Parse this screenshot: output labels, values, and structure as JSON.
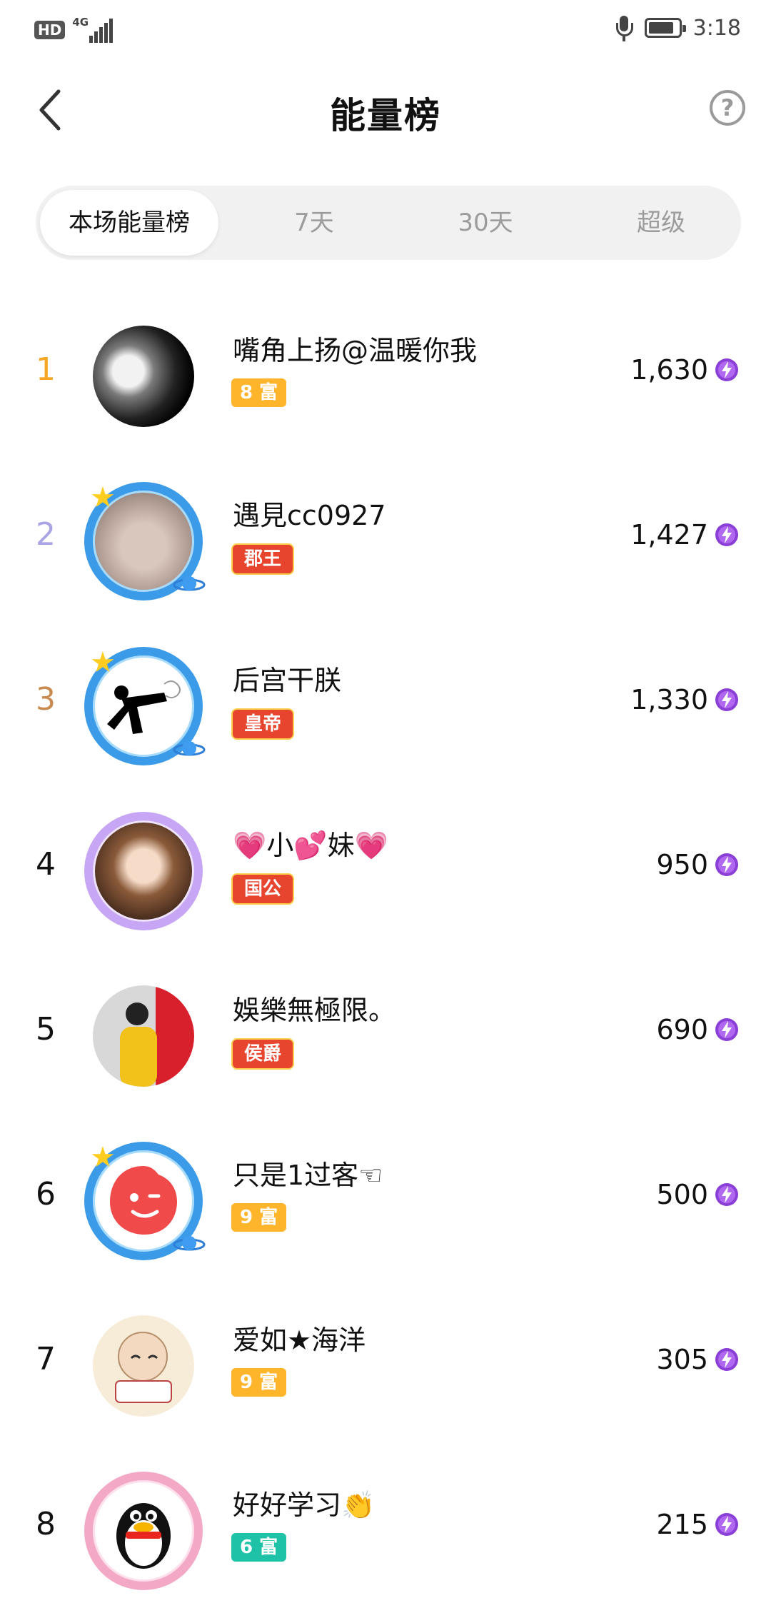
{
  "status_bar": {
    "hd": "HD",
    "network": "4G",
    "time": "3:18"
  },
  "header": {
    "title": "能量榜"
  },
  "tabs": [
    {
      "label": "本场能量榜",
      "active": true
    },
    {
      "label": "7天",
      "active": false
    },
    {
      "label": "30天",
      "active": false
    },
    {
      "label": "超级",
      "active": false
    }
  ],
  "ranking": [
    {
      "rank": "1",
      "name": "嘴角上扬@温暖你我",
      "badge": "8 富",
      "badge_type": "fu",
      "score": "1,630",
      "rank_color": "#f5a623"
    },
    {
      "rank": "2",
      "name": "遇見cc0927",
      "badge": "郡王",
      "badge_type": "title",
      "score": "1,427",
      "rank_color": "#a8a4e6"
    },
    {
      "rank": "3",
      "name": "后宫干朕",
      "badge": "皇帝",
      "badge_type": "title",
      "score": "1,330",
      "rank_color": "#c98a50"
    },
    {
      "rank": "4",
      "name": "💗小💕妹💗",
      "badge": "国公",
      "badge_type": "title",
      "score": "950",
      "rank_color": "#111111"
    },
    {
      "rank": "5",
      "name": "娛樂無極限。",
      "badge": "侯爵",
      "badge_type": "title",
      "score": "690",
      "rank_color": "#111111"
    },
    {
      "rank": "6",
      "name": "只是1过客☜",
      "badge": "9 富",
      "badge_type": "fu",
      "score": "500",
      "rank_color": "#111111"
    },
    {
      "rank": "7",
      "name": "爱如★海洋",
      "badge": "9 富",
      "badge_type": "fu",
      "score": "305",
      "rank_color": "#111111"
    },
    {
      "rank": "8",
      "name": "好好学习👏",
      "badge": "6 富",
      "badge_type": "fu6",
      "score": "215",
      "rank_color": "#111111"
    }
  ],
  "colors": {
    "accent_gold": "#f5a623",
    "energy_purple": "#8a3fd6",
    "tab_bg": "#f1f1f1"
  }
}
